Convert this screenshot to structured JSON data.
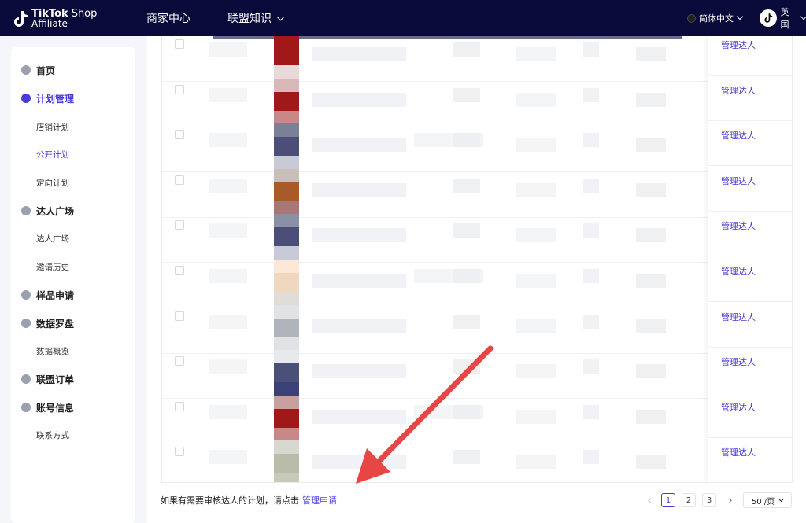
{
  "header": {
    "logo_brand": "TikTok",
    "logo_shop": "Shop",
    "logo_sub": "Affiliate",
    "nav": [
      {
        "label": "商家中心"
      },
      {
        "label": "联盟知识"
      }
    ],
    "language": "简体中文",
    "region": "英国"
  },
  "sidebar": {
    "items": [
      {
        "label": "首页",
        "type": "group",
        "icon": "home-icon"
      },
      {
        "label": "计划管理",
        "type": "group",
        "icon": "plan-icon",
        "active": true
      },
      {
        "label": "店铺计划",
        "type": "sub"
      },
      {
        "label": "公开计划",
        "type": "sub",
        "active": true
      },
      {
        "label": "定向计划",
        "type": "sub"
      },
      {
        "label": "达人广场",
        "type": "group",
        "icon": "search-icon"
      },
      {
        "label": "达人广场",
        "type": "sub"
      },
      {
        "label": "邀请历史",
        "type": "sub"
      },
      {
        "label": "样品申请",
        "type": "group",
        "icon": "box-icon"
      },
      {
        "label": "数据罗盘",
        "type": "group",
        "icon": "compass-icon"
      },
      {
        "label": "数据概览",
        "type": "sub"
      },
      {
        "label": "联盟订单",
        "type": "group",
        "icon": "order-icon"
      },
      {
        "label": "账号信息",
        "type": "group",
        "icon": "user-icon"
      },
      {
        "label": "联系方式",
        "type": "sub"
      }
    ]
  },
  "table": {
    "action_label": "管理达人",
    "row_count": 10,
    "thumb_colors": [
      [
        "#a01818",
        "#a01818",
        "#ead9d9"
      ],
      [
        "#d8b8b8",
        "#a01818",
        "#c88888"
      ],
      [
        "#7a8095",
        "#4a4e78",
        "#c8cad8"
      ],
      [
        "#c8c0b8",
        "#a85a2a",
        "#a87878"
      ],
      [
        "#8a90a5",
        "#4a4e78",
        "#c8cad8"
      ],
      [
        "#fde8d8",
        "#f0d8c0",
        "#e0dcd8"
      ],
      [
        "#e0e2e5",
        "#b0b4bb",
        "#e0e2e5"
      ],
      [
        "#e8e9ec",
        "#4a5078",
        "#3a4078"
      ],
      [
        "#c8a0a0",
        "#a01818",
        "#c88888"
      ],
      [
        "#d8d8d0",
        "#b8bca8",
        "#c8cab8"
      ]
    ]
  },
  "footer": {
    "note": "如果有需要审核达人的计划，请点击",
    "link": "管理申请"
  },
  "pagination": {
    "pages": [
      "1",
      "2",
      "3"
    ],
    "current": "1",
    "page_size": "50 /页"
  },
  "colors": {
    "topbar": "#0a0a3a",
    "accent": "#4a3bd6",
    "annotation_arrow": "#e84545"
  }
}
